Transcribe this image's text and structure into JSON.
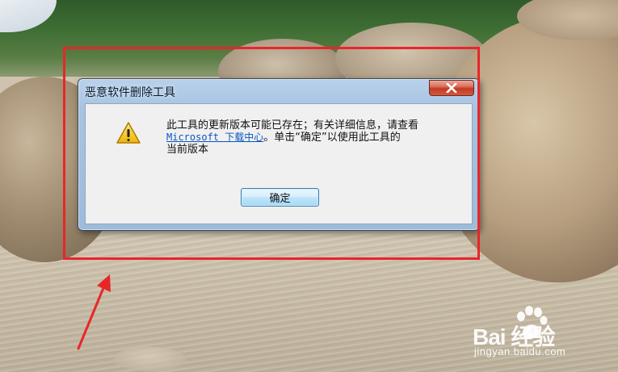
{
  "dialog": {
    "title": "恶意软件删除工具",
    "close_icon": "close-icon",
    "warning_icon": "warning-triangle-icon",
    "message": {
      "line1": "此工具的更新版本可能已存在；有关详细信息，请查看",
      "link_text": "Microsoft 下载中心",
      "line2_rest": "。单击“确定”以使用此工具的",
      "line3": "当前版本"
    },
    "ok_label": "确定"
  },
  "annotation": {
    "highlight_color": "#e8262a"
  },
  "watermark": {
    "brand": "Bai  经验",
    "url": "jingyan.baidu.com"
  }
}
